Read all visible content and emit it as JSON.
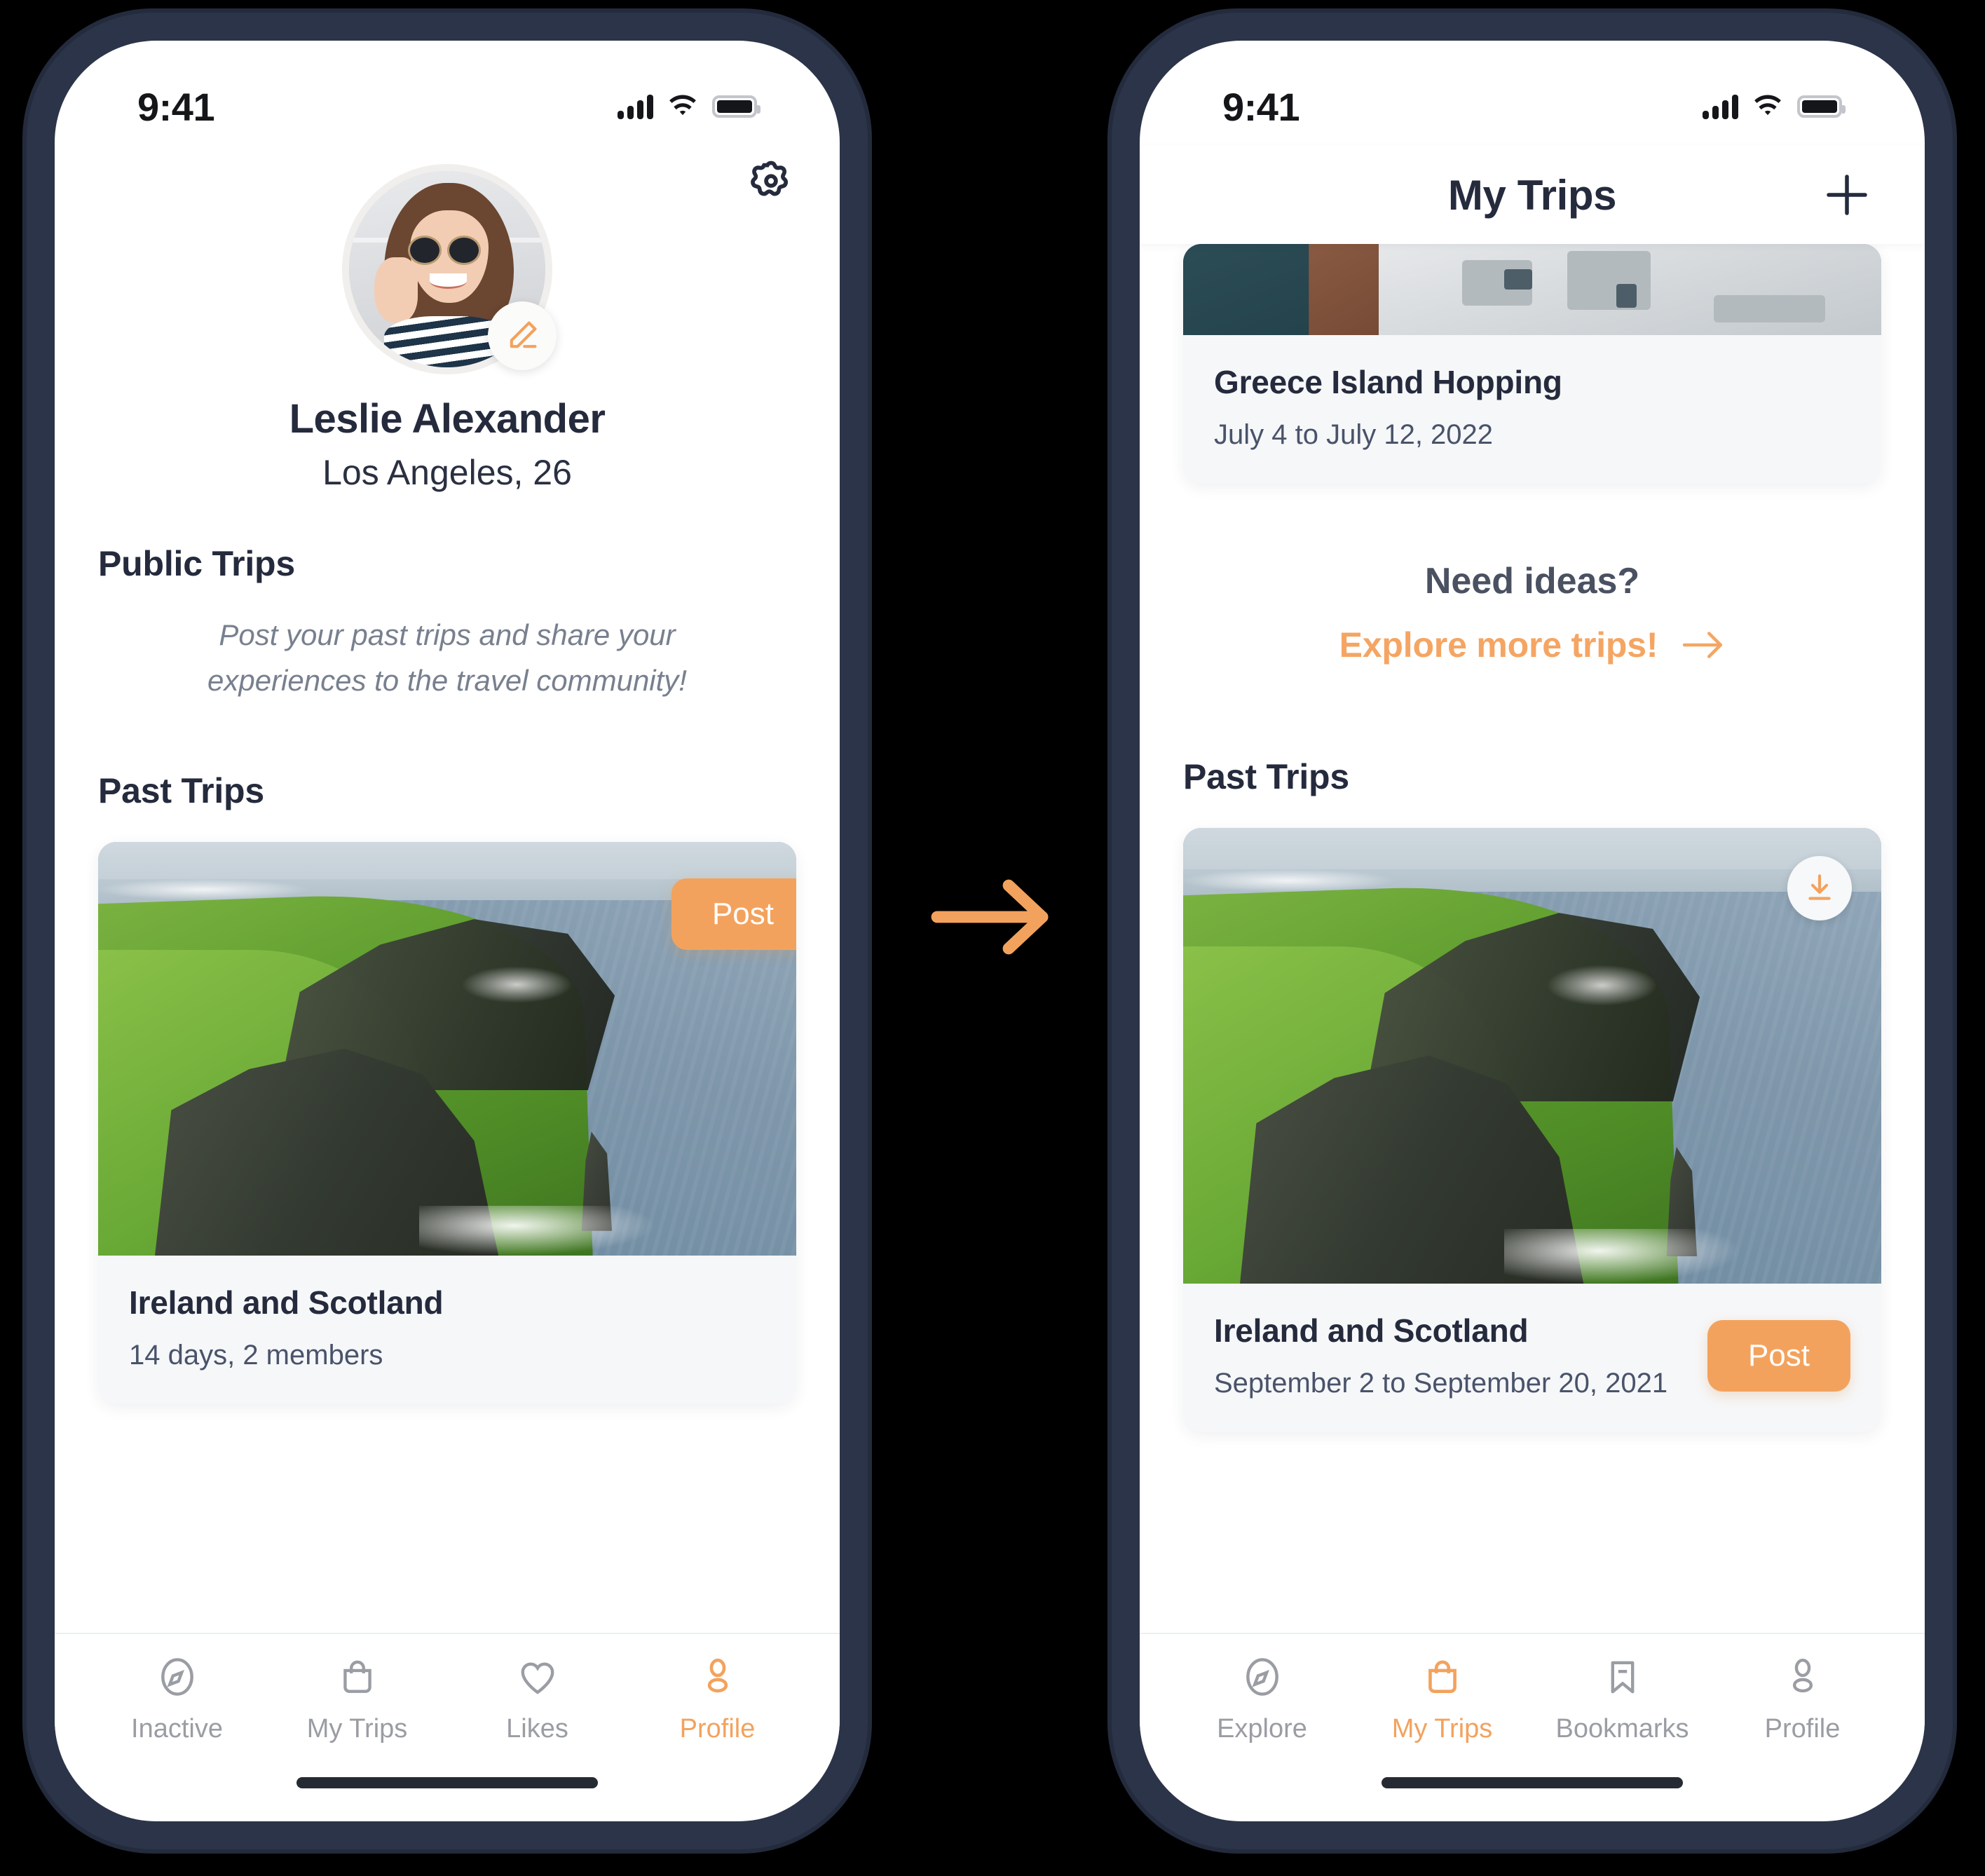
{
  "accent_color": "#f3a25d",
  "dark_color": "#252b3d",
  "muted_color": "#78808f",
  "phone_frame_color": "#2b3448",
  "flow": {
    "arrow_icon": "arrow-right-icon"
  },
  "left_phone": {
    "status_bar": {
      "time": "9:41",
      "icons": [
        "cellular-signal-icon",
        "wifi-icon",
        "battery-icon"
      ]
    },
    "header": {
      "settings_icon": "gear-icon"
    },
    "profile": {
      "avatar_icon": "avatar",
      "edit_icon": "pencil-edit-icon",
      "name": "Leslie Alexander",
      "location_age": "Los Angeles, 26"
    },
    "public_trips": {
      "title": "Public Trips",
      "empty_copy": "Post your past trips and share your experiences to the travel community!"
    },
    "past_trips": {
      "title": "Past Trips",
      "cards": [
        {
          "photo": "cliffs-of-moher-photo",
          "post_label": "Post",
          "title": "Ireland and Scotland",
          "subtitle": "14 days, 2 members"
        }
      ]
    },
    "tabbar": [
      {
        "label": "Inactive",
        "icon": "compass-icon",
        "active": false
      },
      {
        "label": "My Trips",
        "icon": "bag-icon",
        "active": false
      },
      {
        "label": "Likes",
        "icon": "heart-icon",
        "active": false
      },
      {
        "label": "Profile",
        "icon": "person-icon",
        "active": true
      }
    ]
  },
  "right_phone": {
    "status_bar": {
      "time": "9:41",
      "icons": [
        "cellular-signal-icon",
        "wifi-icon",
        "battery-icon"
      ]
    },
    "header": {
      "title": "My Trips",
      "add_icon": "plus-icon"
    },
    "upcoming_card": {
      "photo": "santorini-greece-photo",
      "title": "Greece Island Hopping",
      "subtitle": "July 4 to July 12, 2022"
    },
    "ideas": {
      "title": "Need ideas?",
      "link_label": "Explore more trips!",
      "link_icon": "arrow-right-icon"
    },
    "past_trips": {
      "title": "Past Trips",
      "cards": [
        {
          "photo": "cliffs-of-moher-photo",
          "download_icon": "download-icon",
          "title": "Ireland and Scotland",
          "subtitle": "September 2 to September 20, 2021",
          "post_label": "Post"
        }
      ]
    },
    "tabbar": [
      {
        "label": "Explore",
        "icon": "compass-icon",
        "active": false
      },
      {
        "label": "My Trips",
        "icon": "bag-icon",
        "active": true
      },
      {
        "label": "Bookmarks",
        "icon": "bookmark-icon",
        "active": false
      },
      {
        "label": "Profile",
        "icon": "person-icon",
        "active": false
      }
    ]
  }
}
